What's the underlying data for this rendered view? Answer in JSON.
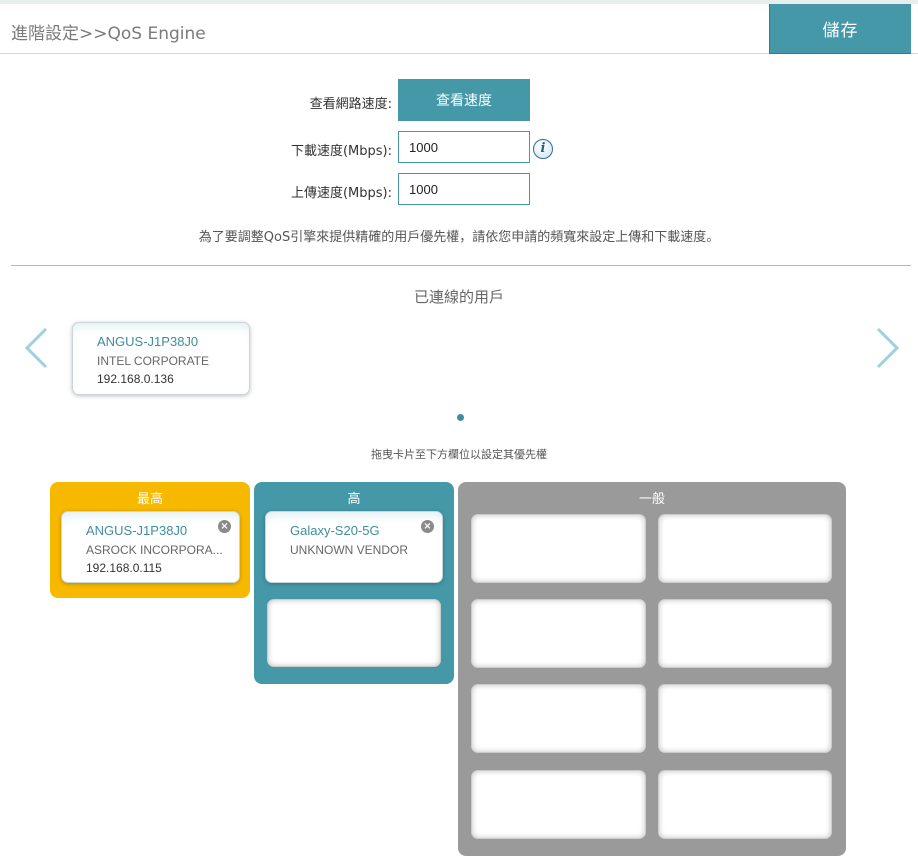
{
  "header": {
    "breadcrumb": "進階設定>>QoS Engine",
    "save_label": "儲存"
  },
  "form": {
    "check_speed_label": "查看網路速度:",
    "check_speed_button": "查看速度",
    "download_label": "下載速度(Mbps):",
    "download_value": "1000",
    "upload_label": "上傳速度(Mbps):",
    "upload_value": "1000",
    "info_icon": "i",
    "note": "為了要調整QoS引擎來提供精確的用戶優先權，請依您申請的頻寬來設定上傳和下載速度。"
  },
  "connected": {
    "title": "已連線的用戶",
    "cards": [
      {
        "name": "ANGUS-J1P38J0",
        "vendor": "INTEL CORPORATE",
        "ip": "192.168.0.136"
      }
    ],
    "drag_hint": "拖曳卡片至下方欄位以設定其優先權"
  },
  "buckets": {
    "highest": {
      "title": "最高",
      "color": "#f7b900",
      "cards": [
        {
          "name": "ANGUS-J1P38J0",
          "vendor": "ASROCK INCORPORA...",
          "ip": "192.168.0.115"
        }
      ]
    },
    "high": {
      "title": "高",
      "color": "#4598a8",
      "cards": [
        {
          "name": "Galaxy-S20-5G",
          "vendor": "UNKNOWN VENDOR"
        }
      ]
    },
    "normal": {
      "title": "一般",
      "color": "#9a9a9a"
    }
  },
  "icons": {
    "prev": "chevron-left-icon",
    "next": "chevron-right-icon",
    "remove": "close-circle-icon",
    "remove_glyph": "×"
  }
}
